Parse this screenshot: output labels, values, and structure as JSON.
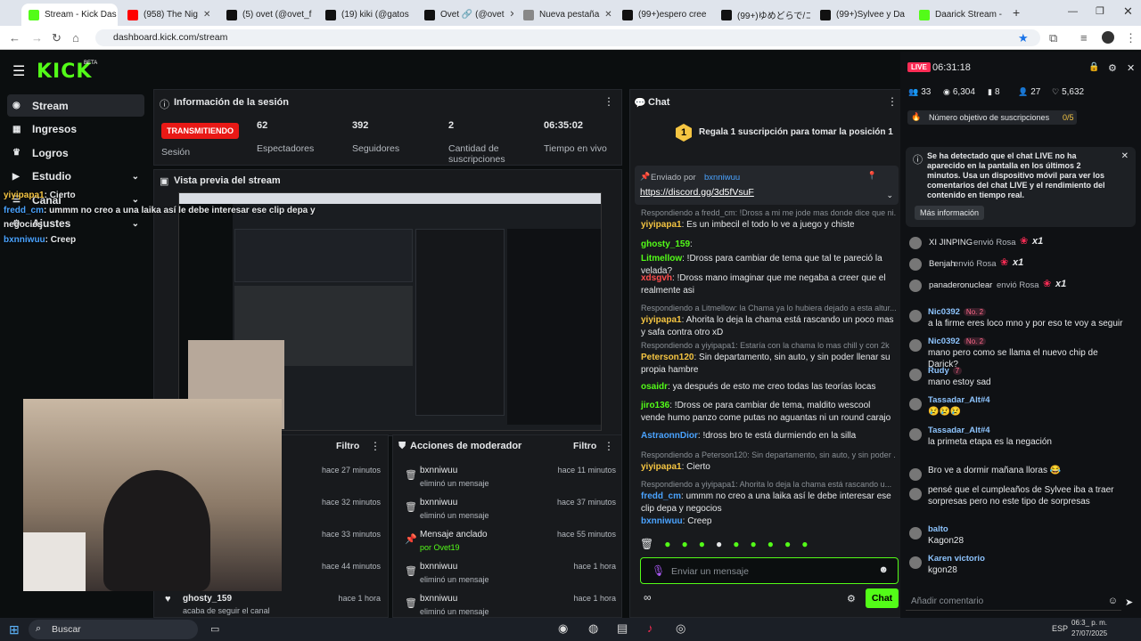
{
  "browser": {
    "tabs": [
      {
        "label": "Stream - Kick Das",
        "color": "#53fc18",
        "active": true
      },
      {
        "label": "(958) The Nig",
        "color": "#ff0000",
        "active": false
      },
      {
        "label": "(5) ovet (@ovet_f",
        "color": "#111111",
        "active": false
      },
      {
        "label": "(19) kiki (@gatos",
        "color": "#111111",
        "active": false
      },
      {
        "label": "Ovet 🔗 (@ovet",
        "color": "#111111",
        "active": false
      },
      {
        "label": "Nueva pestaña",
        "color": "#888888",
        "active": false
      },
      {
        "label": "(99+)espero cree",
        "color": "#111111",
        "active": false
      },
      {
        "label": "(99+)ゆめどらで/コ",
        "color": "#111111",
        "active": false
      },
      {
        "label": "(99+)Sylvee y Da",
        "color": "#111111",
        "active": false
      },
      {
        "label": "Daarick Stream -",
        "color": "#53fc18",
        "active": false
      }
    ],
    "url": "dashboard.kick.com/stream",
    "new_tab": "+"
  },
  "sidenav": {
    "logo": "KICK",
    "beta": "BETA",
    "items": [
      {
        "label": "Stream",
        "icon": "broadcast-icon"
      },
      {
        "label": "Ingresos",
        "icon": "money-icon"
      },
      {
        "label": "Logros",
        "icon": "trophy-icon"
      },
      {
        "label": "Estudio",
        "icon": "studio-icon"
      },
      {
        "label": "Canal",
        "icon": "channel-icon"
      },
      {
        "label": "Ajustes",
        "icon": "settings-icon"
      }
    ]
  },
  "obs_overlay_chat": [
    {
      "user": "yiyipapa1",
      "text": ": Cierto",
      "color": "#f5c542"
    },
    {
      "user": "fredd_cm",
      "text": ": ummm no creo a una laika así le debe interesar ese clip depa y",
      "color": "#4aa3ff"
    },
    {
      "user": "negocios",
      "text": "",
      "color": "#e6e8ea"
    },
    {
      "user": "bxnniwuu",
      "text": ": Creep",
      "color": "#4aa3ff"
    }
  ],
  "session": {
    "title": "Información de la sesión",
    "badge": "TRANSMITIENDO",
    "badge_label": "Sesión",
    "stats": [
      {
        "value": "62",
        "label": "Espectadores"
      },
      {
        "value": "392",
        "label": "Seguidores"
      },
      {
        "value": "2",
        "label": "Cantidad de suscripciones"
      },
      {
        "value": "06:35:02",
        "label": "Tiempo en vivo"
      }
    ]
  },
  "preview": {
    "title": "Vista previa del stream"
  },
  "activity": {
    "filter": "Filtro",
    "rows": [
      {
        "time": "hace 27 minutos"
      },
      {
        "time": "hace 32 minutos"
      },
      {
        "time": "hace 33 minutos"
      },
      {
        "time": "hace 44 minutos"
      },
      {
        "user": "ghosty_159",
        "sub": "acaba de seguir el canal",
        "time": "hace 1 hora"
      }
    ]
  },
  "mod_actions": {
    "title": "Acciones de moderador",
    "filter": "Filtro",
    "rows": [
      {
        "icon": "trash-icon",
        "t1": "bxnniwuu",
        "t2": "eliminó un mensaje",
        "time": "hace 11 minutos"
      },
      {
        "icon": "trash-icon",
        "t1": "bxnniwuu",
        "t2": "eliminó un mensaje",
        "time": "hace 37 minutos"
      },
      {
        "icon": "pin-icon",
        "t1": "Mensaje anclado",
        "t2": "por Ovet19",
        "time": "hace 55 minutos"
      },
      {
        "icon": "trash-icon",
        "t1": "bxnniwuu",
        "t2": "eliminó un mensaje",
        "time": "hace 1 hora"
      },
      {
        "icon": "trash-icon",
        "t1": "bxnniwuu",
        "t2": "eliminó un mensaje",
        "time": "hace 1 hora"
      }
    ]
  },
  "chat": {
    "title": "Chat",
    "goal": "Regala 1 suscripción para tomar la posición 1",
    "goal_rank": "1",
    "pinned_by": "Enviado por",
    "pinned_user": "bxnniwuu",
    "pinned_link": "https://discord.gg/3d5fVsuF",
    "messages": [
      {
        "reply": "Respondiendo a fredd_cm: !Dross a mi me jode mas donde dice que ni...",
        "user": "yiyipapa1",
        "text": ": Es un imbecil el todo lo ve a juego y chiste",
        "color": "#f5c542"
      },
      {
        "user": "ghosty_159",
        "text": ":",
        "color": "#53fc18"
      },
      {
        "user": "Litmellow",
        "text": ": !Dross para cambiar de tema que tal te pareció la velada?",
        "color": "#53fc18"
      },
      {
        "user": "xdsgvh",
        "text": ": !Dross mano imaginar que me negaba a creer que el realmente asi",
        "color": "#ff4d4d"
      },
      {
        "reply": "Respondiendo a Litmellow: la Chama ya lo hubiera dejado a esta altur...",
        "user": "yiyipapa1",
        "text": ": Ahorita lo deja la chama está rascando un poco mas y safa contra otro xD",
        "color": "#f5c542"
      },
      {
        "reply": "Respondiendo a yiyipapa1: Estaría con la chama lo mas chill y con 2k",
        "user": "Peterson120",
        "text": ": Sin departamento, sin auto, y sin poder llenar su propia hambre",
        "color": "#f5c542"
      },
      {
        "user": "osaidr",
        "text": ": ya después de esto me creo todas las teorías locas",
        "color": "#53fc18"
      },
      {
        "user": "jiro136",
        "text": ": !Dross oe para cambiar de tema, maldito wescool vende humo panzo come putas no aguantas ni un round carajo",
        "color": "#53fc18"
      },
      {
        "user": "AstraonnDior",
        "text": ": !dross bro te está durmiendo en la silla",
        "color": "#4aa3ff"
      },
      {
        "reply": "Respondiendo a Peterson120: Sin departamento, sin auto, y sin poder ...",
        "user": "yiyipapa1",
        "text": ": Cierto",
        "color": "#f5c542"
      },
      {
        "reply": "Respondiendo a yiyipapa1: Ahorita lo deja la chama está rascando u...",
        "user": "fredd_cm",
        "text": ": ummm no creo a una laika así le debe interesar ese clip depa y negocios",
        "color": "#4aa3ff"
      },
      {
        "user": "bxnniwuu",
        "text": ": Creep",
        "color": "#4aa3ff"
      }
    ],
    "input_placeholder": "Enviar un mensaje",
    "send": "Chat"
  },
  "live_overlay": {
    "live": "LIVE",
    "timer": "06:31:18",
    "stats": [
      {
        "icon": "viewers-icon",
        "value": "33"
      },
      {
        "icon": "eye-icon",
        "value": "6,304"
      },
      {
        "icon": "bars-icon",
        "value": "8"
      },
      {
        "icon": "users-icon",
        "value": "27"
      },
      {
        "icon": "heart-icon",
        "value": "5,632"
      }
    ],
    "sub_goal": "Número objetivo de suscripciones",
    "sub_goal_progress": "0/5",
    "notice": "Se ha detectado que el chat LIVE no ha aparecido en la pantalla en los últimos 2 minutos. Usa un dispositivo móvil para ver los comentarios del chat LIVE y el rendimiento del contenido en tiempo real.",
    "notice_more": "Más información",
    "gifts": [
      {
        "user": "XI JINPING",
        "text": "envió Rosa",
        "count": "x1"
      },
      {
        "user": "Benjah",
        "text": "envió Rosa",
        "count": "x1"
      },
      {
        "user": "panaderonuclear",
        "text": "envió Rosa",
        "count": "x1"
      }
    ],
    "comments": [
      {
        "user": "Nic0392",
        "badge": "No. 2",
        "text": "a la firme eres loco mno y por eso te voy a seguir"
      },
      {
        "user": "Nic0392",
        "badge": "No. 2",
        "text": "mano pero como se llama el nuevo chip de Darick?"
      },
      {
        "user": "Rudy",
        "badge": "7",
        "text": "mano estoy sad"
      },
      {
        "user": "Tassadar_Alt#4",
        "badge": "",
        "text": "😢😢😢"
      },
      {
        "user": "Tassadar_Alt#4",
        "badge": "",
        "text": "la primeta etapa es la negación"
      },
      {
        "user": "",
        "badge": "",
        "text": "Bro ve a dormir mañana lloras 😂"
      },
      {
        "user": "",
        "badge": "",
        "text": "pensé que el cumpleaños de Sylvee iba a traer sorpresas pero no este tipo de sorpresas"
      },
      {
        "user": "balto",
        "badge": "",
        "text": "Kagon28"
      },
      {
        "user": "Karen victorio",
        "badge": "",
        "text": "kgon28"
      }
    ],
    "comment_placeholder": "Añadir comentario"
  },
  "taskbar": {
    "search": "Buscar",
    "lang": "ESP",
    "time": "06:3_ p. m.",
    "date": "27/07/2025"
  },
  "colors": {
    "kick_green": "#53fc18",
    "live_red": "#fe2c55",
    "badge_red": "#e91916"
  }
}
